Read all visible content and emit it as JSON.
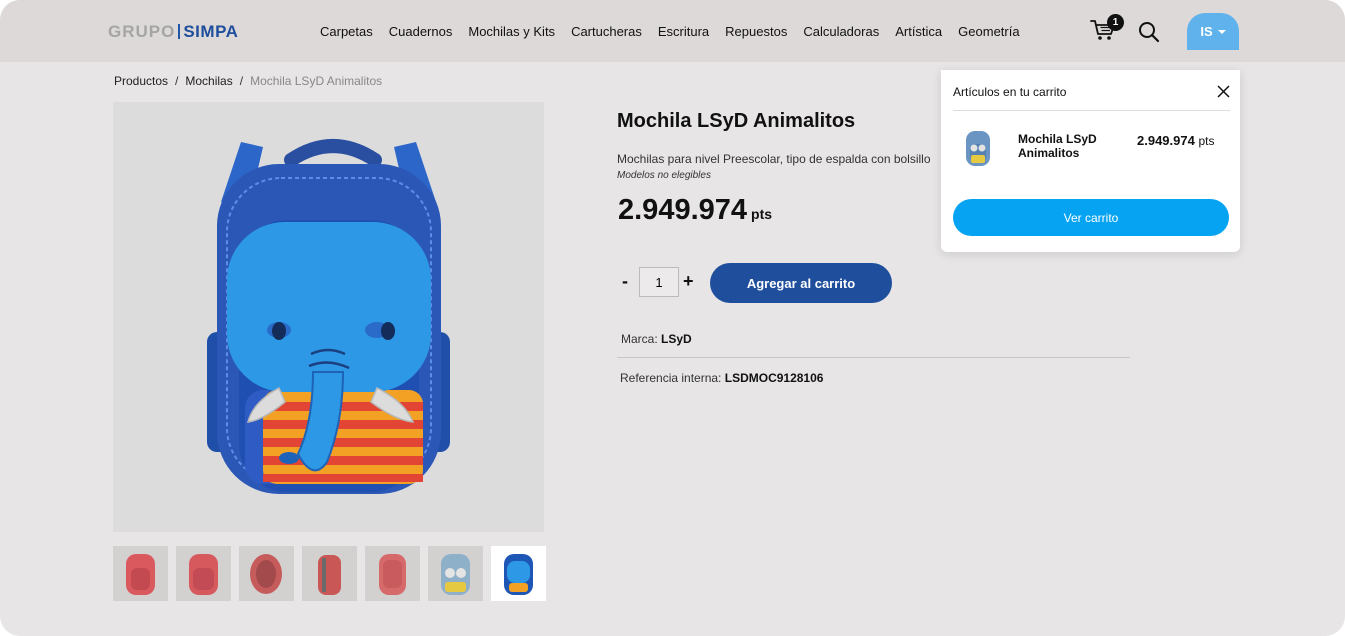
{
  "brand": {
    "left": "GRUPO",
    "right": "SIMPA"
  },
  "nav": [
    "Carpetas",
    "Cuadernos",
    "Mochilas y Kits",
    "Cartucheras",
    "Escritura",
    "Repuestos",
    "Calculadoras",
    "Artística",
    "Geometría"
  ],
  "header": {
    "cart_count": "1",
    "user_initials": "IS"
  },
  "breadcrumb": {
    "items": [
      "Productos",
      "Mochilas"
    ],
    "separator": "/",
    "current": "Mochila LSyD Animalitos"
  },
  "product": {
    "title": "Mochila LSyD Animalitos",
    "description": "Mochilas para nivel Preescolar, tipo de espalda con bolsillo",
    "note": "Modelos no elegibles",
    "price": "2.949.974",
    "price_unit": "pts",
    "quantity": "1",
    "qty_minus": "-",
    "qty_plus": "+",
    "add_to_cart_label": "Agregar al carrito",
    "brand_label": "Marca:",
    "brand_value": "LSyD",
    "ref_label": "Referencia interna:",
    "ref_value": "LSDMOC9128106"
  },
  "thumbnails": [
    {
      "color": "#d9595f",
      "active": false
    },
    {
      "color": "#d65a5d",
      "active": false
    },
    {
      "color": "#c65b5b",
      "active": false
    },
    {
      "color": "#c95756",
      "active": false
    },
    {
      "color": "#d66a6a",
      "active": false
    },
    {
      "color": "#8fb0c9",
      "active": false
    },
    {
      "color": "#1e56b5",
      "active": true
    }
  ],
  "cart_popup": {
    "title": "Artículos en tu carrito",
    "item_name": "Mochila LSyD Animalitos",
    "item_price": "2.949.974",
    "item_price_unit": "pts",
    "view_cart_label": "Ver carrito"
  },
  "colors": {
    "primary": "#1f4e9c",
    "accent": "#06a3f2",
    "user": "#5fb2eb"
  }
}
